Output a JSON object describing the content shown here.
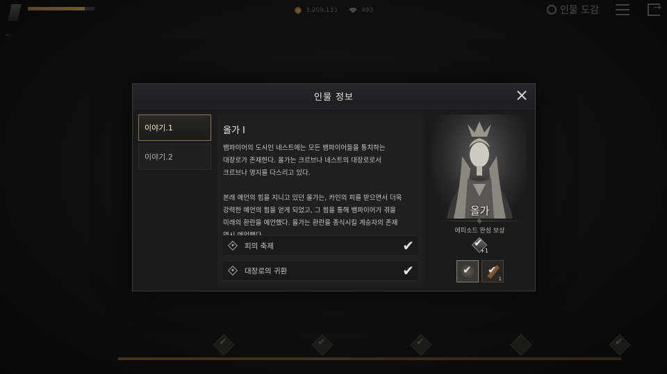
{
  "hud": {
    "gold": "3,209,133",
    "gems": "493",
    "collection_label": "인물 도감",
    "level_progress": 0.85
  },
  "modal": {
    "title": "인물 정보",
    "tabs": [
      {
        "label": "이야기.1",
        "active": true
      },
      {
        "label": "이야기.2",
        "active": false
      }
    ],
    "story_title": "올가 I",
    "story_text": "뱀파이어의 도시인 네스트에는 모든 뱀파이어들을 통치하는\n대장로가 존재한다. 올가는 크르브나 네스트의 대장로로서\n크르브나 영지를 다스리고 있다.\n\n본래 예언의 힘을 지니고 있던 올가는, 카인의 피를 받으면서 더욱\n강력한 예언의 힘을 얻게 되었고, 그 힘을 통해 뱀파이어가 겪을\n미래의 환란을 예언했다. 올가는 환란을 종식시킬 계승자의 존재\n역시 예언했다.",
    "episodes": [
      {
        "label": "피의 축제",
        "completed": true
      },
      {
        "label": "대장로의 귀환",
        "completed": true
      }
    ],
    "character": {
      "name": "올가",
      "reward_label": "에피소드 완성 보상",
      "reward_bonus": "+1",
      "reward_slot_count": "1"
    }
  }
}
